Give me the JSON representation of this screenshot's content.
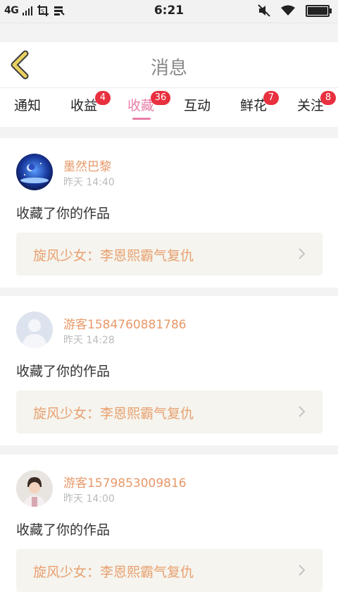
{
  "status_bar": {
    "network": "4G",
    "time": "6:21"
  },
  "header": {
    "title": "消息"
  },
  "tabs": [
    {
      "label": "通知",
      "badge": ""
    },
    {
      "label": "收益",
      "badge": "4"
    },
    {
      "label": "收藏",
      "badge": "36"
    },
    {
      "label": "互动",
      "badge": ""
    },
    {
      "label": "鲜花",
      "badge": "7"
    },
    {
      "label": "关注",
      "badge": "8"
    }
  ],
  "active_tab": "收藏",
  "messages": [
    {
      "username": "墨然巴黎",
      "time": "昨天 14:40",
      "action": "收藏了你的作品",
      "work_title": "旋风少女：李恩熙霸气复仇",
      "avatar": "night-sky-avatar"
    },
    {
      "username": "游客1584760881786",
      "time": "昨天 14:28",
      "action": "收藏了你的作品",
      "work_title": "旋风少女：李恩熙霸气复仇",
      "avatar": "default-avatar"
    },
    {
      "username": "游客1579853009816",
      "time": "昨天 14:00",
      "action": "收藏了你的作品",
      "work_title": "旋风少女：李恩熙霸气复仇",
      "avatar": "photo-avatar"
    }
  ],
  "colors": {
    "accent": "#e87ea8",
    "badge": "#e8303e",
    "username": "#e89868",
    "work_title": "#e8a070",
    "back_arrow": "#e8d060"
  }
}
